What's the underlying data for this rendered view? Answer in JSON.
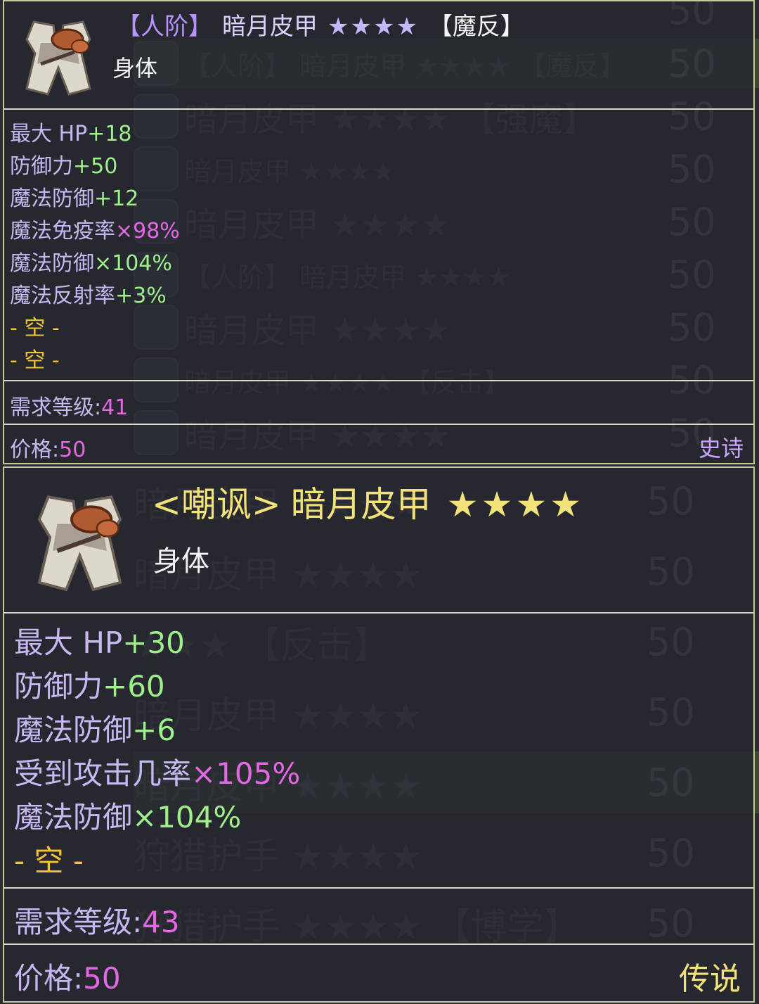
{
  "background_list": {
    "rows": [
      {
        "name": "",
        "level": "50",
        "icon": "none"
      },
      {
        "name": "【人阶】 暗月皮甲 ★★★★ 【魔反】",
        "level": "50",
        "icon": "clock-icon",
        "highlight": true
      },
      {
        "name": "暗月皮甲 ★★★★ 【强魔】",
        "level": "50",
        "icon": "armor-icon"
      },
      {
        "name": "暗月皮甲 ★★★★",
        "level": "50",
        "icon": "armor-icon"
      },
      {
        "name": "暗月皮甲 ★★★★",
        "level": "50",
        "icon": "clock-icon"
      },
      {
        "name": "【人阶】 暗月皮甲 ★★★★",
        "level": "50",
        "icon": "clock-icon"
      },
      {
        "name": "暗月皮甲 ★★★★",
        "level": "50",
        "icon": "new-badge-icon"
      },
      {
        "name": "暗月皮甲 ★★★★ 【反击】",
        "level": "50",
        "icon": "clock-icon"
      },
      {
        "name": "暗月皮甲 ★★★★",
        "level": "50",
        "icon": "new-badge-icon"
      },
      {
        "name": "暗月皮甲 ★★★★",
        "level": "50",
        "icon": "none"
      },
      {
        "name": "暗月皮甲 ★★★★",
        "level": "50",
        "icon": "none"
      },
      {
        "name": "★★★ 【反击】",
        "level": "50",
        "icon": "none"
      },
      {
        "name": "暗月皮甲 ★★★★",
        "level": "50",
        "icon": "none"
      },
      {
        "name": "暗月皮甲 ★★★★",
        "level": "50",
        "icon": "none",
        "highlight": true
      },
      {
        "name": "狩猎护手 ★★★★",
        "level": "50",
        "icon": "none"
      },
      {
        "name": "狩猎护手 ★★★★ 【博学】",
        "level": "50",
        "icon": "none"
      }
    ]
  },
  "tooltip_1": {
    "title": {
      "bracket": "【人阶】",
      "name": "暗月皮甲",
      "stars": "★★★★",
      "suffix": "【魔反】"
    },
    "slot": "身体",
    "stats": [
      {
        "name": "最大 HP",
        "value": "+18",
        "kind": "plus"
      },
      {
        "name": "防御力",
        "value": "+50",
        "kind": "plus"
      },
      {
        "name": "魔法防御",
        "value": "+12",
        "kind": "plus"
      },
      {
        "name": "魔法免疫率",
        "value": "×98%",
        "kind": "mult"
      },
      {
        "name": "魔法防御",
        "value": "×104%",
        "kind": "mult-green"
      },
      {
        "name": "魔法反射率",
        "value": "+3%",
        "kind": "plus"
      }
    ],
    "empty_slots": [
      "- 空 -",
      "- 空 -"
    ],
    "req_label": "需求等级:",
    "req_value": "41",
    "price_label": "价格:",
    "price_value": "50",
    "rarity": "史诗"
  },
  "tooltip_2": {
    "title": {
      "tag": "<嘲讽>",
      "name": "暗月皮甲",
      "stars": "★★★★"
    },
    "slot": "身体",
    "stats": [
      {
        "name": "最大 HP",
        "value": "+30",
        "kind": "plus"
      },
      {
        "name": "防御力",
        "value": "+60",
        "kind": "plus"
      },
      {
        "name": "魔法防御",
        "value": "+6",
        "kind": "plus"
      },
      {
        "name": "受到攻击几率",
        "value": "×105%",
        "kind": "mult"
      },
      {
        "name": "魔法防御",
        "value": "×104%",
        "kind": "mult-green"
      }
    ],
    "empty_slots": [
      "- 空 -"
    ],
    "req_label": "需求等级:",
    "req_value": "43",
    "price_label": "价格:",
    "price_value": "50",
    "rarity": "传说"
  },
  "colors": {
    "epic_purple": "#c8a8ff",
    "legend_gold": "#f2e27a",
    "stat_green": "#9ef08a",
    "stat_magenta": "#e468e4",
    "empty_gold": "#f0c43a",
    "border": "#c9c89a"
  }
}
